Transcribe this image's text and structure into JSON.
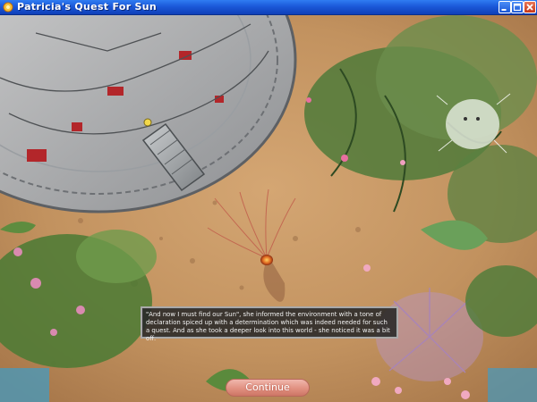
{
  "window": {
    "title": "Patricia's Quest For Sun",
    "controls": [
      "minimize-icon",
      "maximize-icon",
      "close-icon"
    ]
  },
  "scene": {
    "narrative": "\"And now I must find our Sun\", she informed the environment with a tone of declaration spiced up with a determination which was indeed needed for such a quest. And as she took a deeper look into this world - she noticed it was a bit off.",
    "continue_label": "Continue"
  },
  "colors": {
    "titlebar": "#1b59d9",
    "ground": "#c99a66",
    "textbox_bg": "#282828",
    "continue_button": "#e19181"
  }
}
